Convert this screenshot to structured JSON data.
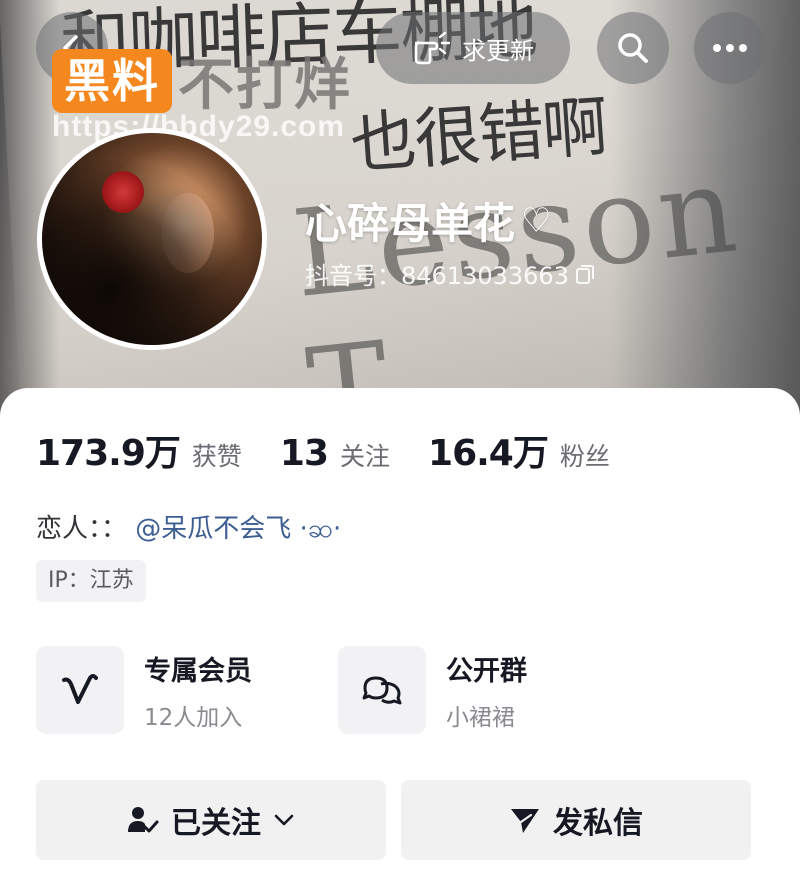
{
  "header": {
    "update_label": "求更新",
    "icons": [
      "back-icon",
      "hand-point-icon",
      "search-icon",
      "more-icon"
    ]
  },
  "watermark": {
    "badge": "黑料",
    "text": "不打烊",
    "url": "https://bbdy29.com",
    "color": "#f5871f"
  },
  "background": {
    "scribble_line1": "和咖啡店车棚地",
    "scribble_line2": "也很错啊",
    "lesson_text": "Lesson T"
  },
  "profile": {
    "nickname": "心碎母单花",
    "nickname_suffix": "♡",
    "account_id": "抖音号：84613033663",
    "copy_icon": "copy-icon"
  },
  "stats": [
    {
      "value": "173.9万",
      "label": "获赞"
    },
    {
      "value": "13",
      "label": "关注"
    },
    {
      "value": "16.4万",
      "label": "粉丝"
    }
  ],
  "bio": {
    "prefix": "恋人：：",
    "mention": "@呆瓜不会飞 ·ဆ·"
  },
  "ip": "IP：江苏",
  "features": {
    "member": {
      "title": "专属会员",
      "subtitle": "12人加入",
      "icon": "v-logo-icon"
    },
    "group": {
      "title": "公开群",
      "subtitle": "小裙裙",
      "icon": "chat-bubbles-icon"
    }
  },
  "actions": {
    "follow_label": "已关注",
    "message_label": "发私信"
  },
  "colors": {
    "mention": "#3d5e93",
    "text_primary": "#161823",
    "text_secondary": "#6b6c72",
    "button_bg": "#f1f1f2"
  }
}
